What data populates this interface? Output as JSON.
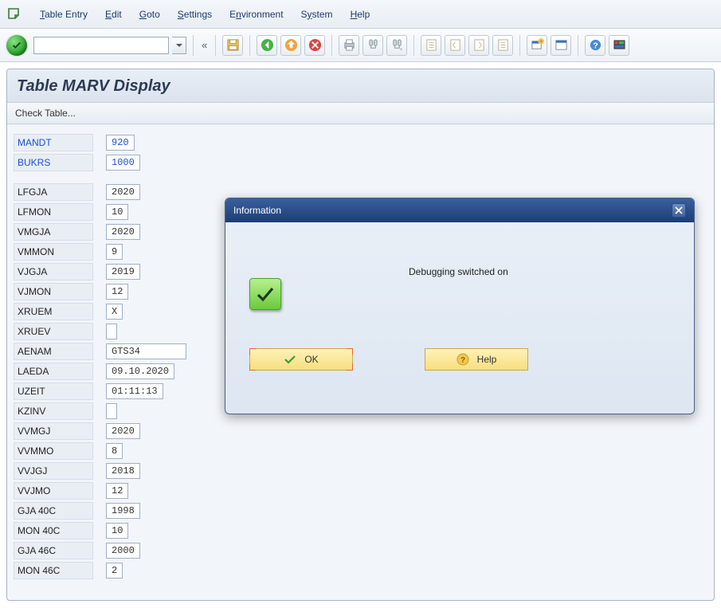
{
  "menu": {
    "items": [
      "Table Entry",
      "Edit",
      "Goto",
      "Settings",
      "Environment",
      "System",
      "Help"
    ]
  },
  "toolbar": {
    "command_value": "",
    "chevrons": "«"
  },
  "title": "Table MARV Display",
  "subbar": {
    "check_label": "Check Table..."
  },
  "fields": {
    "keys": [
      {
        "label": "MANDT",
        "value": "920"
      },
      {
        "label": "BUKRS",
        "value": "1000"
      }
    ],
    "rows": [
      {
        "label": "LFGJA",
        "value": "2020"
      },
      {
        "label": "LFMON",
        "value": "10"
      },
      {
        "label": "VMGJA",
        "value": "2020"
      },
      {
        "label": "VMMON",
        "value": "9"
      },
      {
        "label": "VJGJA",
        "value": "2019"
      },
      {
        "label": "VJMON",
        "value": "12"
      },
      {
        "label": "XRUEM",
        "value": "X"
      },
      {
        "label": "XRUEV",
        "value": ""
      },
      {
        "label": "AENAM",
        "value": "GTS34"
      },
      {
        "label": "LAEDA",
        "value": "09.10.2020"
      },
      {
        "label": "UZEIT",
        "value": "01:11:13"
      },
      {
        "label": "KZINV",
        "value": ""
      },
      {
        "label": "VVMGJ",
        "value": "2020"
      },
      {
        "label": "VVMMO",
        "value": "8"
      },
      {
        "label": "VVJGJ",
        "value": "2018"
      },
      {
        "label": "VVJMO",
        "value": "12"
      },
      {
        "label": "GJA 40C",
        "value": "1998"
      },
      {
        "label": "MON 40C",
        "value": "10"
      },
      {
        "label": "GJA 46C",
        "value": "2000"
      },
      {
        "label": "MON 46C",
        "value": "2"
      }
    ]
  },
  "dialog": {
    "title": "Information",
    "message": "Debugging switched on",
    "ok_label": "OK",
    "help_label": "Help"
  }
}
